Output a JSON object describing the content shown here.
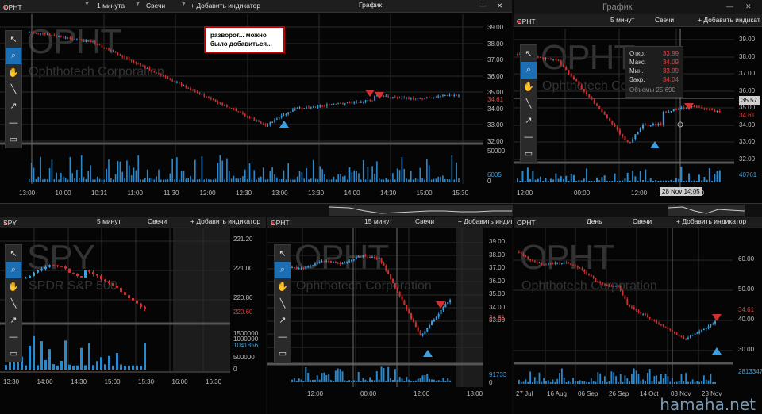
{
  "colors": {
    "up": "#3aa0e0",
    "down": "#d03030",
    "vol": "#2a8ad0",
    "grid": "#2a2a2a"
  },
  "main_window": {
    "title": "График",
    "close": "✕",
    "minimize": "—"
  },
  "right_window": {
    "title": "График",
    "close": "✕",
    "minimize": "—"
  },
  "panels": [
    {
      "id": "p1",
      "symbol": "OPHT",
      "interval": "1 минута",
      "style": "Свечи",
      "add": "+ Добавить индикатор",
      "watermark_symbol": "OPHT",
      "watermark_name": "Ophthotech Corporation",
      "y_ticks": [
        "39.00",
        "38.00",
        "37.00",
        "36.00",
        "35.00",
        "34.00",
        "33.00",
        "32.00"
      ],
      "last_price": "34.61",
      "vol_ticks": [
        "50000",
        "6005",
        "0"
      ],
      "x_ticks": [
        "13:00",
        "10:00",
        "10:31",
        "11:00",
        "11:30",
        "12:00",
        "12:30",
        "13:00",
        "13:30",
        "14:00",
        "14:30",
        "15:00",
        "15:30"
      ],
      "note": "разворот... можно было добавиться..."
    },
    {
      "id": "p2",
      "symbol": "OPHT",
      "interval": "5 минут",
      "style": "Свечи",
      "add": "+ Добавить индикат",
      "watermark_symbol": "OPHT",
      "watermark_name": "Ophthotech Corporation",
      "y_ticks": [
        "39.00",
        "38.00",
        "37.00",
        "36.00",
        "35.00",
        "34.00",
        "33.00",
        "32.00"
      ],
      "last_price": "34.61",
      "crosshair_price": "35.57",
      "vol_ticks": [
        "40761"
      ],
      "x_ticks": [
        "12:00",
        "00:00",
        "12:00",
        "16:00"
      ],
      "crosshair_time": "28 Nov 14:05",
      "tooltip": [
        {
          "k": "Откр.",
          "v": "33.99"
        },
        {
          "k": "Макс.",
          "v": "34.09"
        },
        {
          "k": "Мин.",
          "v": "33.99"
        },
        {
          "k": "Закр.",
          "v": "34.04"
        }
      ],
      "tooltip_vol_label": "Объемы",
      "tooltip_vol": "25,690"
    },
    {
      "id": "p3",
      "symbol": "SPY",
      "interval": "5 минут",
      "style": "Свечи",
      "add": "+ Добавить индикатор",
      "watermark_symbol": "SPY",
      "watermark_name": "SPDR S&P 500",
      "y_ticks": [
        "221.20",
        "221.00",
        "220.80"
      ],
      "last_price": "220.60",
      "vol_ticks": [
        "1500000",
        "1000000",
        "1041856",
        "500000",
        "0"
      ],
      "x_ticks": [
        "13:30",
        "14:00",
        "14:30",
        "15:00",
        "15:30",
        "16:00",
        "16:30"
      ]
    },
    {
      "id": "p4",
      "symbol": "OPHT",
      "interval": "15 минут",
      "style": "Свечи",
      "add": "+ Добавить индикат",
      "watermark_symbol": "OPHT",
      "watermark_name": "Ophthotech Corporation",
      "y_ticks": [
        "39.00",
        "38.00",
        "37.00",
        "36.00",
        "35.00",
        "34.00",
        "33.00"
      ],
      "last_price": "34.61",
      "vol_ticks": [
        "91733",
        "0"
      ],
      "x_ticks": [
        "12:00",
        "00:00",
        "12:00",
        "18:00"
      ]
    },
    {
      "id": "p5",
      "symbol": "OPHT",
      "interval": "День",
      "style": "Свечи",
      "add": "+ Добавить индикатор",
      "watermark_symbol": "OPHT",
      "watermark_name": "Ophthotech Corporation",
      "y_ticks": [
        "60.00",
        "50.00",
        "40.00",
        "30.00"
      ],
      "last_price": "34.61",
      "vol_ticks": [
        "2813347"
      ],
      "x_ticks": [
        "27 Jul",
        "16 Aug",
        "06 Sep",
        "26 Sep",
        "14 Oct",
        "03 Nov",
        "23 Nov"
      ]
    }
  ],
  "tools": [
    "arrow-icon",
    "zoom-icon",
    "hand-icon",
    "line-icon",
    "ray-icon",
    "hline-icon",
    "rect-icon"
  ],
  "watermark": "hamaha.net"
}
